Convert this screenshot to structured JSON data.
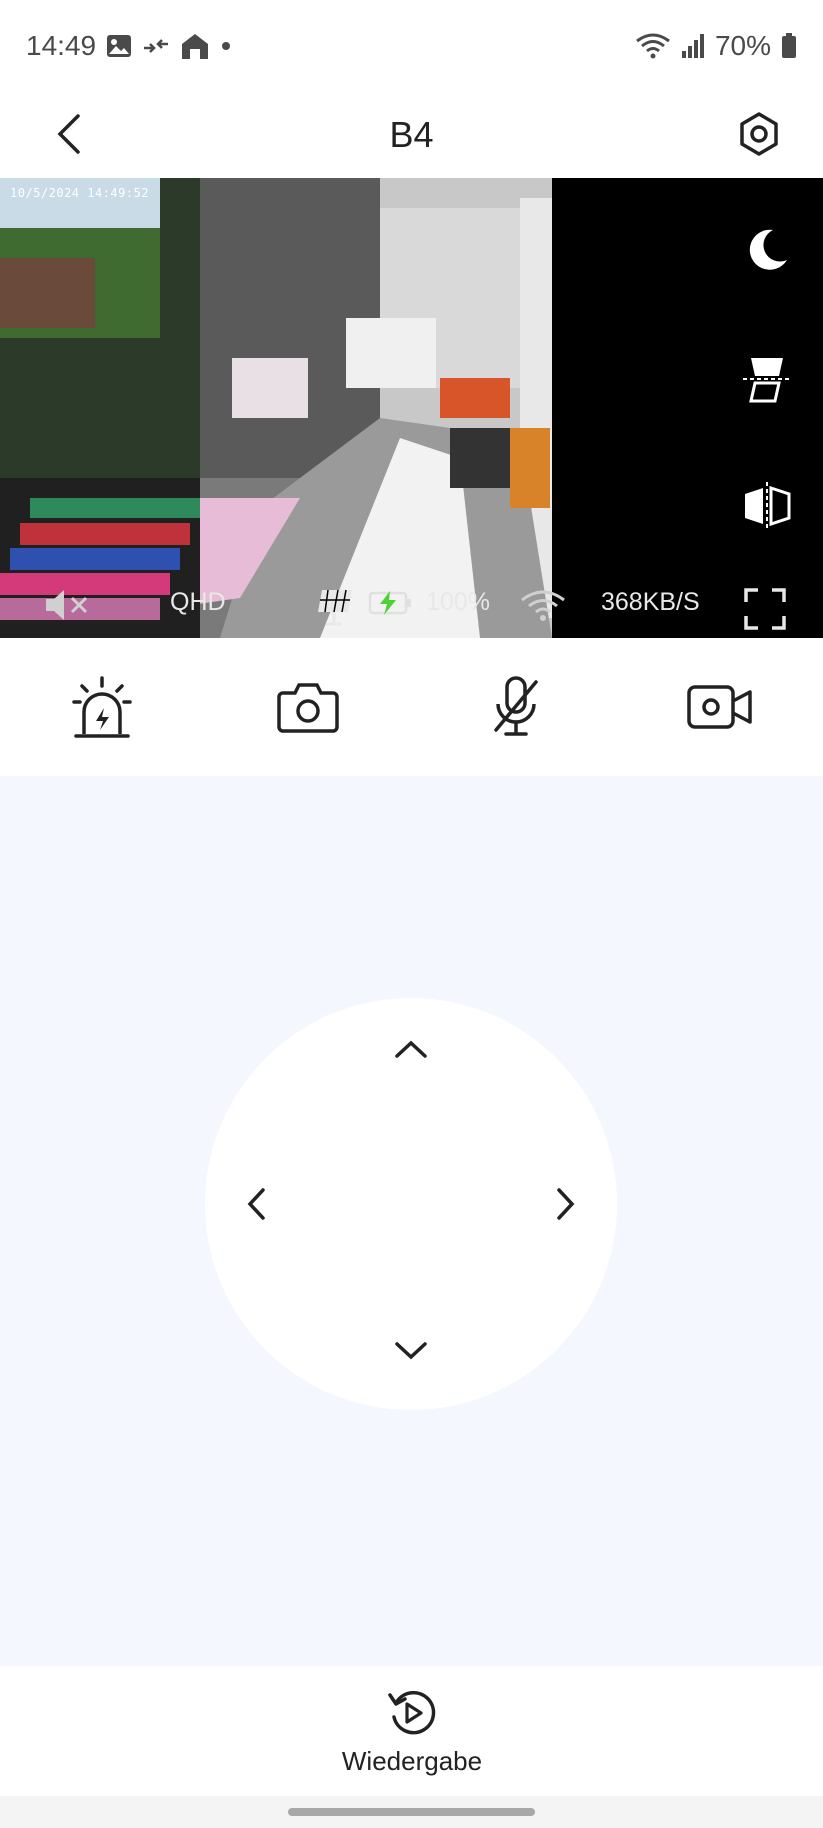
{
  "status_bar": {
    "time": "14:49",
    "battery_percent": "70%",
    "icons": [
      "image-icon",
      "data-transfer-icon",
      "home-icon",
      "notification-dot-icon",
      "wifi-icon",
      "signal-icon",
      "battery-icon"
    ]
  },
  "header": {
    "title": "B4",
    "back_icon": "chevron-left-icon",
    "settings_icon": "gear-hexagon-icon"
  },
  "video": {
    "timestamp": "10/5/2024 14:49:52",
    "quality": "QHD",
    "battery_level": "100%",
    "bitrate": "368KB/S",
    "side_tools": [
      "night-mode-icon",
      "flip-vertical-icon",
      "mirror-icon"
    ],
    "overlay_icons": [
      "mute-icon",
      "solar-panel-icon",
      "battery-charging-icon",
      "wifi-icon",
      "fullscreen-icon"
    ]
  },
  "actions": {
    "items": [
      "siren-icon",
      "snapshot-camera-icon",
      "microphone-muted-icon",
      "video-record-icon"
    ]
  },
  "ptz": {
    "directions": [
      "up",
      "left",
      "right",
      "down"
    ]
  },
  "bottom": {
    "playback_label": "Wiedergabe"
  },
  "colors": {
    "accent": "#222222",
    "ptz_background": "#f4f7fd",
    "video_background": "#000000",
    "charging_green": "#4cd137"
  }
}
